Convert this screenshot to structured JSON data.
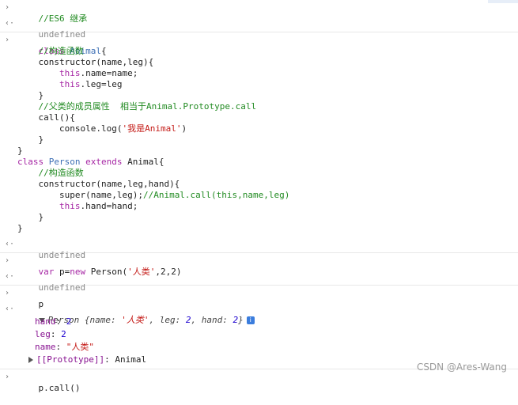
{
  "console": {
    "cmd1": "//ES6 继承",
    "undefined": "undefined",
    "code": {
      "l1_kw": "class",
      "l1_name": "Animal",
      "l1_rest": "{",
      "l2": "//构造函数",
      "l3": "constructor(name,leg){",
      "l4_kw": "this",
      "l4_rest": ".name=name;",
      "l5_kw": "this",
      "l5_rest": ".leg=leg",
      "l6": "}",
      "l7": "//父类的成员属性  相当于Animal.Prototype.call",
      "l8": "call(){",
      "l9_a": "console.log(",
      "l9_str": "'我是Animal'",
      "l9_b": ")",
      "l10": "}",
      "l11": "}",
      "l12_kw": "class",
      "l12_name": "Person",
      "l12_ext": "extends",
      "l12_rest": "Animal{",
      "l13": "//构造函数",
      "l14": "constructor(name,leg,hand){",
      "l15_a": "super(name,leg);",
      "l15_cm": "//Animal.call(this,name,leg)",
      "l16_kw": "this",
      "l16_rest": ".hand=hand;",
      "l17": "}",
      "l18": "}"
    },
    "cmd3": {
      "kw": "var",
      "a": " p=",
      "kw2": "new",
      "b": " Person(",
      "str": "'人类'",
      "c": ",2,2)"
    },
    "cmd4": "p",
    "result": {
      "summary_class": "Person",
      "summary_open": " {name: ",
      "summary_name": "'人类'",
      "summary_mid": ", leg: ",
      "summary_leg": "2",
      "summary_mid2": ", hand: ",
      "summary_hand": "2",
      "summary_close": "}",
      "info": "i",
      "props": [
        {
          "key": "hand",
          "value": "2"
        },
        {
          "key": "leg",
          "value": "2"
        },
        {
          "key": "name",
          "value": "\"人类\""
        }
      ],
      "proto_key": "[[Prototype]]",
      "proto_value": "Animal"
    },
    "cmd5": "p.call()",
    "watermark": "CSDN @Ares-Wang"
  }
}
